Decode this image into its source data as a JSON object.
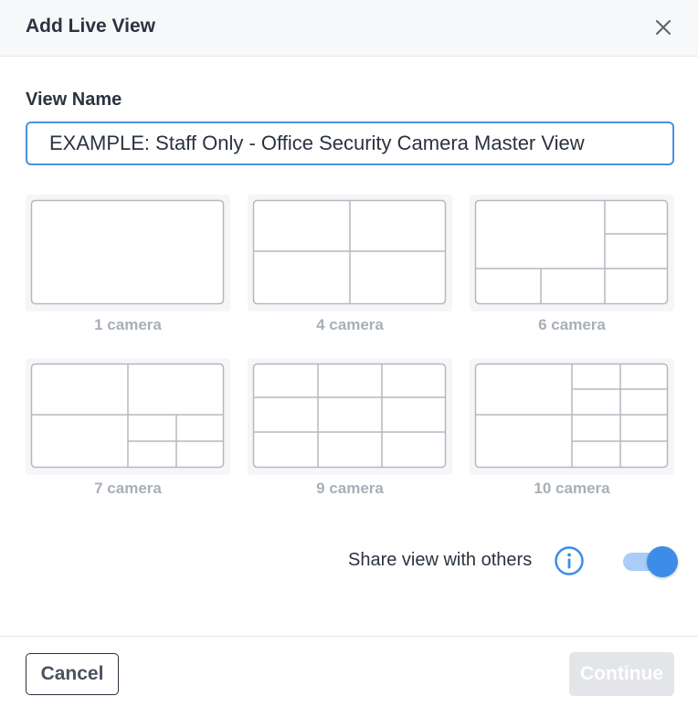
{
  "dialog": {
    "title": "Add Live View"
  },
  "form": {
    "name_label": "View Name",
    "name_placeholder": "EXAMPLE: Staff Only - Office Security Camera Master View",
    "name_value": ""
  },
  "layouts": [
    {
      "label": "1 camera",
      "cameras": 1
    },
    {
      "label": "4 camera",
      "cameras": 4
    },
    {
      "label": "6 camera",
      "cameras": 6
    },
    {
      "label": "7 camera",
      "cameras": 7
    },
    {
      "label": "9 camera",
      "cameras": 9
    },
    {
      "label": "10 camera",
      "cameras": 10
    }
  ],
  "share": {
    "label": "Share view with others",
    "enabled": true
  },
  "footer": {
    "cancel_label": "Cancel",
    "continue_label": "Continue"
  },
  "colors": {
    "accent": "#3d8de8",
    "input_border": "#4a90e2",
    "muted_label": "#a9afb8",
    "disabled_button": "#e3e5e8"
  }
}
